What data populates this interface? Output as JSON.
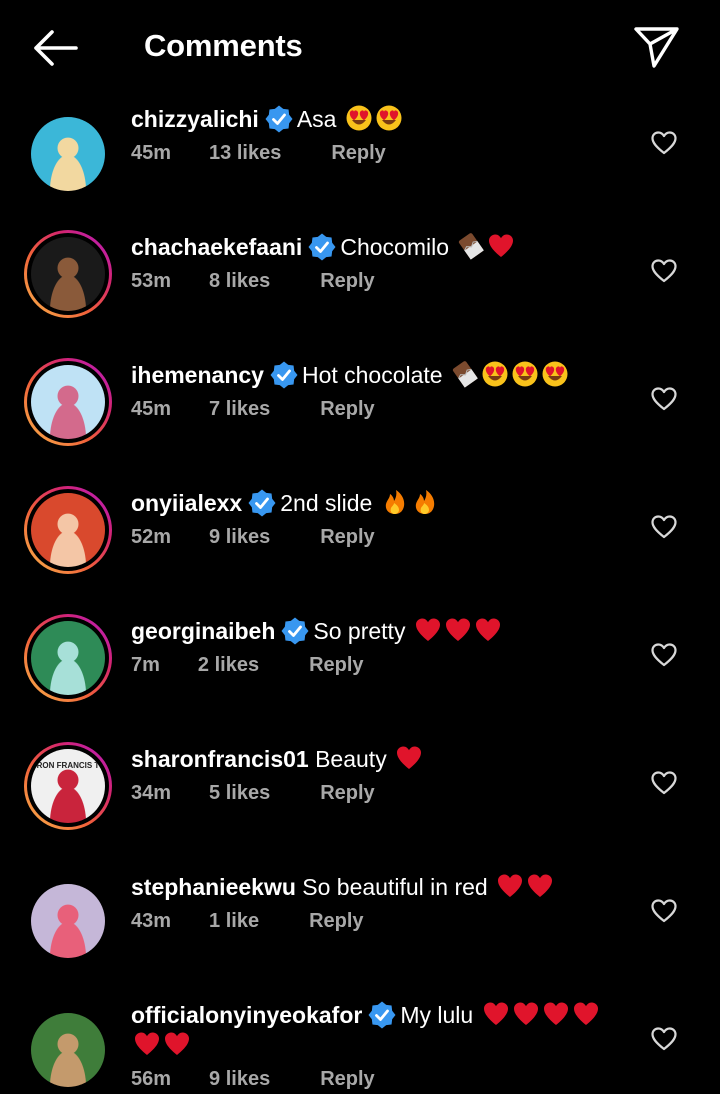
{
  "header": {
    "title": "Comments",
    "back_icon": "back-arrow-icon",
    "send_icon": "paper-plane-icon"
  },
  "colors": {
    "background": "#000000",
    "meta": "#a8a8a8",
    "verified": "#3897f0",
    "heart_emoji": "#e0142b"
  },
  "comments": [
    {
      "username": "chizzyalichi",
      "verified": true,
      "text": "Asa",
      "emojis": [
        "heart-eyes-emoji",
        "heart-eyes-emoji"
      ],
      "time": "45m",
      "likes": "13 likes",
      "reply": "Reply",
      "story_ring": false
    },
    {
      "username": "chachaekefaani",
      "verified": true,
      "text": "Chocomilo",
      "emojis": [
        "chocolate-emoji",
        "red-heart-emoji"
      ],
      "time": "53m",
      "likes": "8 likes",
      "reply": "Reply",
      "story_ring": true
    },
    {
      "username": "ihemenancy",
      "verified": true,
      "text": "Hot chocolate",
      "emojis": [
        "chocolate-emoji",
        "heart-eyes-emoji",
        "heart-eyes-emoji",
        "heart-eyes-emoji"
      ],
      "time": "45m",
      "likes": "7 likes",
      "reply": "Reply",
      "story_ring": true
    },
    {
      "username": "onyiialexx",
      "verified": true,
      "text": "2nd slide",
      "emojis": [
        "fire-emoji",
        "fire-emoji"
      ],
      "time": "52m",
      "likes": "9 likes",
      "reply": "Reply",
      "story_ring": true
    },
    {
      "username": "georginaibeh",
      "verified": true,
      "text": "So pretty",
      "emojis": [
        "red-heart-emoji",
        "red-heart-emoji",
        "red-heart-emoji"
      ],
      "time": "7m",
      "likes": "2 likes",
      "reply": "Reply",
      "story_ring": true
    },
    {
      "username": "sharonfrancis01",
      "verified": false,
      "text": "Beauty",
      "emojis": [
        "red-heart-emoji"
      ],
      "time": "34m",
      "likes": "5 likes",
      "reply": "Reply",
      "story_ring": true,
      "avatar_text": "RON FRANCIS T"
    },
    {
      "username": "stephanieekwu",
      "verified": false,
      "text": "So beautiful in red",
      "emojis": [
        "red-heart-emoji",
        "red-heart-emoji"
      ],
      "time": "43m",
      "likes": "1 like",
      "reply": "Reply",
      "story_ring": false
    },
    {
      "username": "officialonyinyeokafor",
      "verified": true,
      "text": "My lulu",
      "emojis": [
        "red-heart-emoji",
        "red-heart-emoji",
        "red-heart-emoji",
        "red-heart-emoji"
      ],
      "emojis_line2": [
        "red-heart-emoji",
        "red-heart-emoji"
      ],
      "time": "56m",
      "likes": "9 likes",
      "reply": "Reply",
      "story_ring": false
    }
  ]
}
